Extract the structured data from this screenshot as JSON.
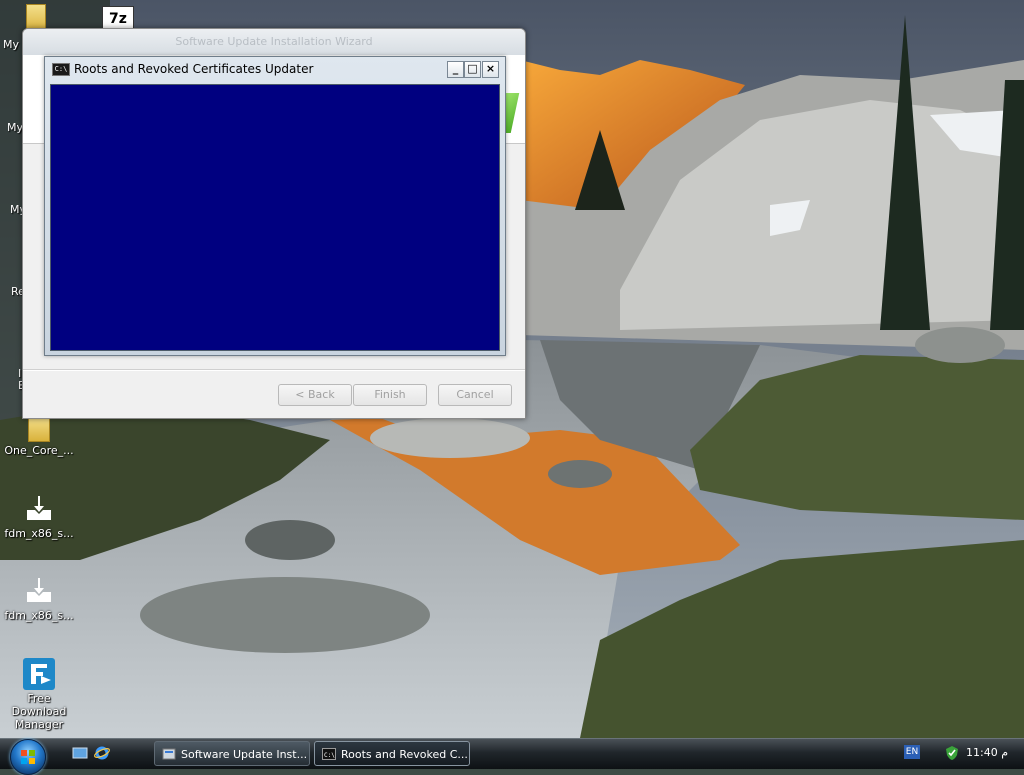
{
  "desktop": {
    "icons": [
      {
        "name": "one-core-folder",
        "label": "One_Core_..."
      },
      {
        "name": "fdm-installer-1",
        "label": "fdm_x86_s..."
      },
      {
        "name": "fdm-installer-2",
        "label": "fdm_x86_s..."
      },
      {
        "name": "free-download-manager",
        "label": "Free Download Manager"
      }
    ],
    "partial_labels": [
      "My",
      "My",
      "My",
      "Re",
      "I",
      "E"
    ],
    "zip_icon_text": "7z"
  },
  "wizard": {
    "title": "Software Update Installation Wizard",
    "buttons": {
      "back": "< Back",
      "finish": "Finish",
      "cancel": "Cancel"
    }
  },
  "console": {
    "title": "Roots and Revoked Certificates Updater",
    "icon_text": "C:\\",
    "controls": {
      "minimize": "_",
      "maximize": "□",
      "close": "×"
    },
    "background": "#000080"
  },
  "taskbar": {
    "buttons": [
      {
        "label": "Software Update Inst...",
        "active": false
      },
      {
        "label": "Roots and Revoked C...",
        "active": true
      }
    ],
    "tray": {
      "language": "EN",
      "clock": "11:40 م"
    }
  }
}
